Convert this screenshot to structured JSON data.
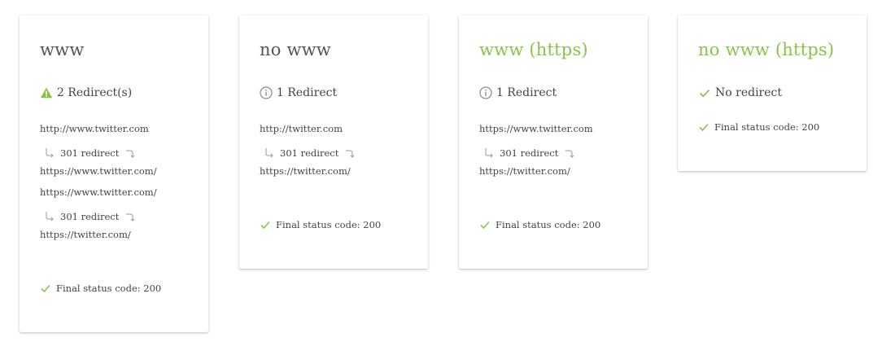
{
  "colors": {
    "accent_green": "#8bc34a",
    "warning": "#8bc34a",
    "text": "#444444",
    "muted_icon": "#8a8a8a"
  },
  "cards": [
    {
      "title": "www",
      "title_color": "dark",
      "status": {
        "icon": "warning-icon",
        "text": "2 Redirect(s)"
      },
      "chain": [
        {
          "kind": "url",
          "text": "http://www.twitter.com"
        },
        {
          "kind": "hop",
          "text": "301 redirect"
        },
        {
          "kind": "url",
          "text": "https://www.twitter.com/"
        },
        {
          "kind": "url",
          "text": "https://www.twitter.com/"
        },
        {
          "kind": "hop",
          "text": "301 redirect"
        },
        {
          "kind": "url",
          "text": "https://twitter.com/"
        }
      ],
      "final": "Final status code: 200"
    },
    {
      "title": "no www",
      "title_color": "dark",
      "status": {
        "icon": "info-icon",
        "text": "1 Redirect"
      },
      "chain": [
        {
          "kind": "url",
          "text": "http://twitter.com"
        },
        {
          "kind": "hop",
          "text": "301 redirect"
        },
        {
          "kind": "url",
          "text": "https://twitter.com/"
        }
      ],
      "final": "Final status code: 200"
    },
    {
      "title": "www (https)",
      "title_color": "green",
      "status": {
        "icon": "info-icon",
        "text": "1 Redirect"
      },
      "chain": [
        {
          "kind": "url",
          "text": "https://www.twitter.com"
        },
        {
          "kind": "hop",
          "text": "301 redirect"
        },
        {
          "kind": "url",
          "text": "https://twitter.com/"
        }
      ],
      "final": "Final status code: 200"
    },
    {
      "title": "no www (https)",
      "title_color": "green",
      "status": {
        "icon": "check-icon",
        "text": "No redirect"
      },
      "chain": [],
      "final": "Final status code: 200"
    }
  ]
}
